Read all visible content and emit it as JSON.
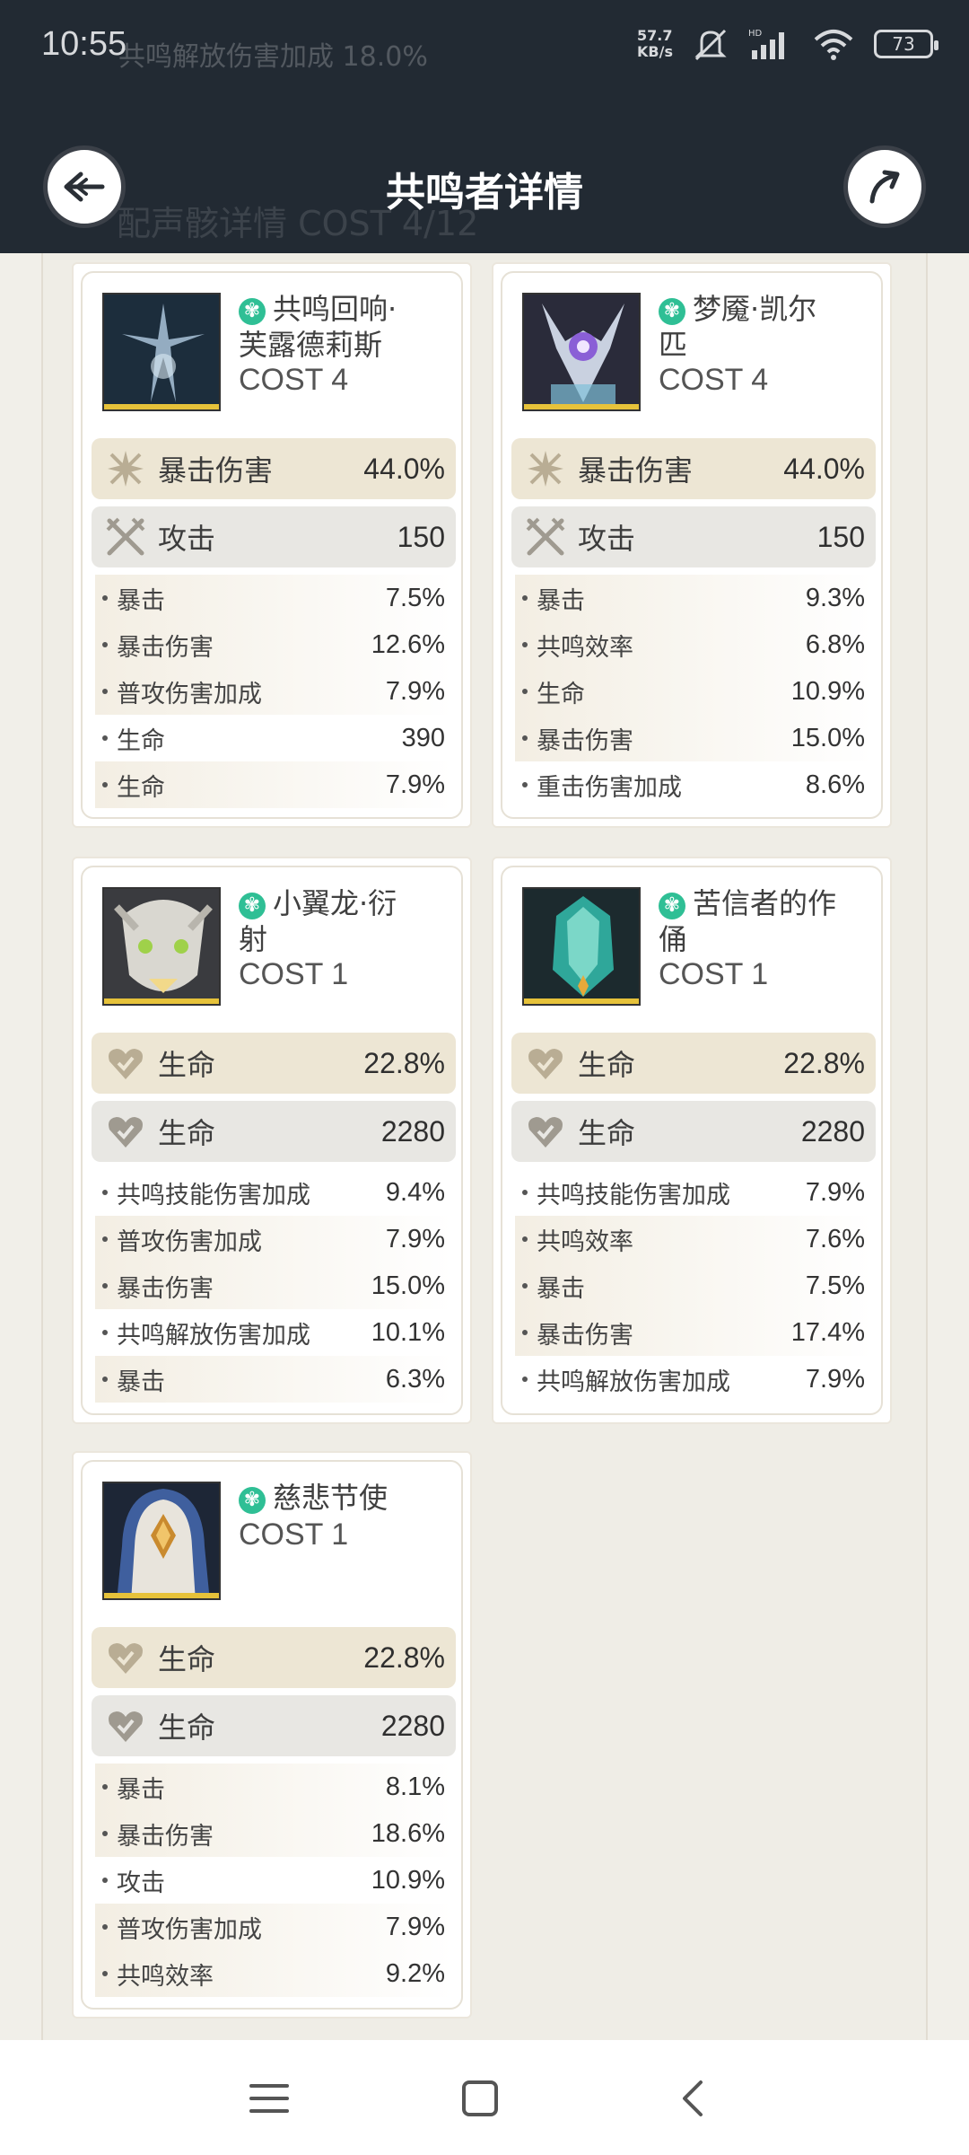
{
  "status_bar": {
    "time": "10:55",
    "overlay_text": "共鸣解放伤害加成    18.0%",
    "net_speed_value": "57.7",
    "net_speed_unit": "KB/s",
    "battery": "73"
  },
  "app_bar": {
    "title": "共鸣者详情",
    "overlay_text": "配声骸详情  COST 4/12"
  },
  "cards": [
    {
      "name_line1": "共鸣回响·",
      "name_line2": "芙露德莉斯",
      "cost": "COST 4",
      "main1": {
        "label": "暴击伤害",
        "value": "44.0%",
        "icon": "crit-damage-icon"
      },
      "main2": {
        "label": "攻击",
        "value": "150",
        "icon": "attack-icon"
      },
      "subs": [
        {
          "label": "暴击",
          "value": "7.5%"
        },
        {
          "label": "暴击伤害",
          "value": "12.6%"
        },
        {
          "label": "普攻伤害加成",
          "value": "7.9%"
        },
        {
          "label": "生命",
          "value": "390"
        },
        {
          "label": "生命",
          "value": "7.9%"
        }
      ]
    },
    {
      "name_line1": "梦魇·凯尔",
      "name_line2": "匹",
      "cost": "COST 4",
      "main1": {
        "label": "暴击伤害",
        "value": "44.0%",
        "icon": "crit-damage-icon"
      },
      "main2": {
        "label": "攻击",
        "value": "150",
        "icon": "attack-icon"
      },
      "subs": [
        {
          "label": "暴击",
          "value": "9.3%"
        },
        {
          "label": "共鸣效率",
          "value": "6.8%"
        },
        {
          "label": "生命",
          "value": "10.9%"
        },
        {
          "label": "暴击伤害",
          "value": "15.0%"
        },
        {
          "label": "重击伤害加成",
          "value": "8.6%"
        }
      ]
    },
    {
      "name_line1": "小翼龙·衍",
      "name_line2": "射",
      "cost": "COST 1",
      "main1": {
        "label": "生命",
        "value": "22.8%",
        "icon": "hp-icon"
      },
      "main2": {
        "label": "生命",
        "value": "2280",
        "icon": "hp-icon"
      },
      "subs": [
        {
          "label": "共鸣技能伤害加成",
          "value": "9.4%"
        },
        {
          "label": "普攻伤害加成",
          "value": "7.9%"
        },
        {
          "label": "暴击伤害",
          "value": "15.0%"
        },
        {
          "label": "共鸣解放伤害加成",
          "value": "10.1%"
        },
        {
          "label": "暴击",
          "value": "6.3%"
        }
      ]
    },
    {
      "name_line1": "苦信者的作",
      "name_line2": "俑",
      "cost": "COST 1",
      "main1": {
        "label": "生命",
        "value": "22.8%",
        "icon": "hp-icon"
      },
      "main2": {
        "label": "生命",
        "value": "2280",
        "icon": "hp-icon"
      },
      "subs": [
        {
          "label": "共鸣技能伤害加成",
          "value": "7.9%"
        },
        {
          "label": "共鸣效率",
          "value": "7.6%"
        },
        {
          "label": "暴击",
          "value": "7.5%"
        },
        {
          "label": "暴击伤害",
          "value": "17.4%"
        },
        {
          "label": "共鸣解放伤害加成",
          "value": "7.9%"
        }
      ]
    },
    {
      "name_line1": "慈悲节使",
      "name_line2": "",
      "cost": "COST 1",
      "main1": {
        "label": "生命",
        "value": "22.8%",
        "icon": "hp-icon"
      },
      "main2": {
        "label": "生命",
        "value": "2280",
        "icon": "hp-icon"
      },
      "subs": [
        {
          "label": "暴击",
          "value": "8.1%"
        },
        {
          "label": "暴击伤害",
          "value": "18.6%"
        },
        {
          "label": "攻击",
          "value": "10.9%"
        },
        {
          "label": "普攻伤害加成",
          "value": "7.9%"
        },
        {
          "label": "共鸣效率",
          "value": "9.2%"
        }
      ]
    }
  ],
  "colors": {
    "header_bg": "#222a33",
    "page_bg": "#f1efe9",
    "main_stat_primary": "#ede6d4",
    "main_stat_secondary": "#e8e7e3",
    "sonata_badge": "#2fbf95",
    "thumb_quality_bar": "#e6c23a"
  }
}
